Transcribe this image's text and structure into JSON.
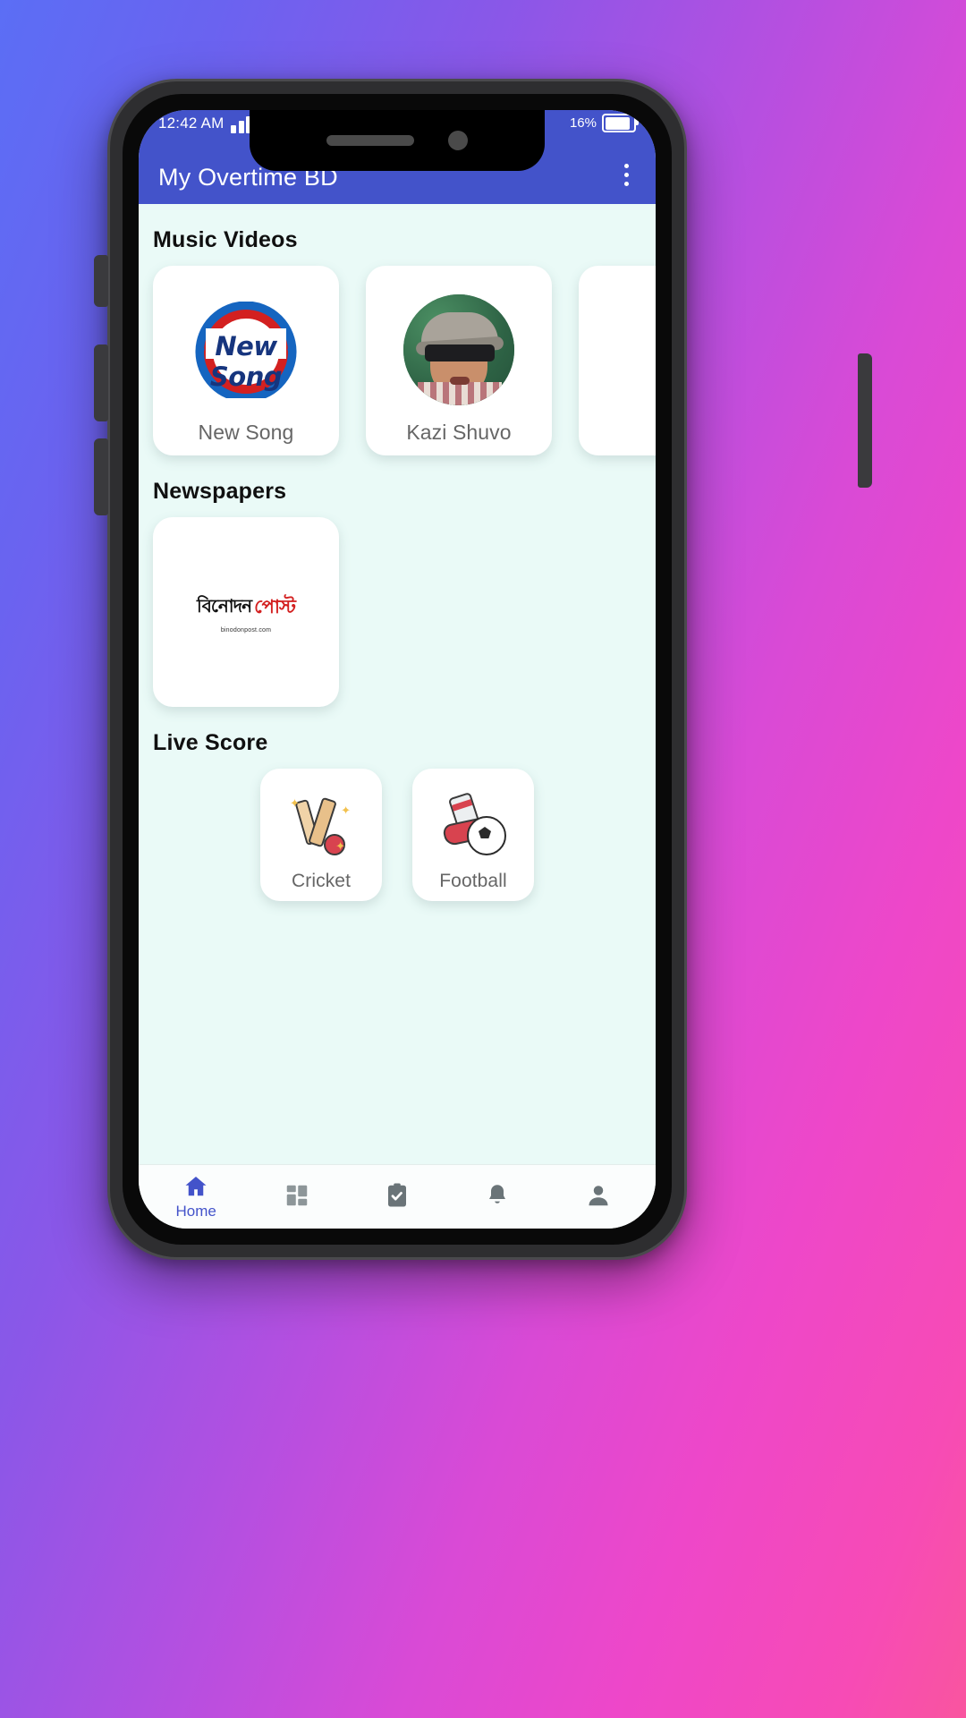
{
  "status_bar": {
    "time": "12:42 AM",
    "signal_icon": "signal-bars-icon",
    "wifi_icon": "wifi-icon",
    "battery_text": "16%",
    "battery_icon": "battery-icon"
  },
  "app_bar": {
    "title": "My Overtime BD",
    "menu_icon": "overflow-menu-icon"
  },
  "theme": {
    "header_color": "#4353ca",
    "page_bg": "#eafaf7",
    "accent": "#4353ca",
    "card_bg": "#ffffff",
    "label_color": "#666666"
  },
  "sections": [
    {
      "title": "Music Videos",
      "items": [
        {
          "label": "New Song",
          "thumb": "new-song-logo"
        },
        {
          "label": "Kazi Shuvo",
          "thumb": "kazi-shuvo-portrait"
        },
        {
          "label": "",
          "thumb": "partial-card"
        }
      ]
    },
    {
      "title": "Newspapers",
      "items": [
        {
          "label": "",
          "thumb": "binodon-post-logo",
          "logo_bn": "বিনোদন",
          "logo_red": "পোস্ট",
          "logo_url": "binodonpost.com"
        }
      ]
    },
    {
      "title": "Live Score",
      "items": [
        {
          "label": "Cricket",
          "thumb": "cricket-icon"
        },
        {
          "label": "Football",
          "thumb": "football-icon"
        }
      ]
    }
  ],
  "bottom_nav": [
    {
      "label": "Home",
      "icon": "home-icon",
      "active": true
    },
    {
      "label": "",
      "icon": "dashboard-icon",
      "active": false
    },
    {
      "label": "",
      "icon": "tasks-checklist-icon",
      "active": false
    },
    {
      "label": "",
      "icon": "bell-notification-icon",
      "active": false
    },
    {
      "label": "",
      "icon": "person-profile-icon",
      "active": false
    }
  ]
}
